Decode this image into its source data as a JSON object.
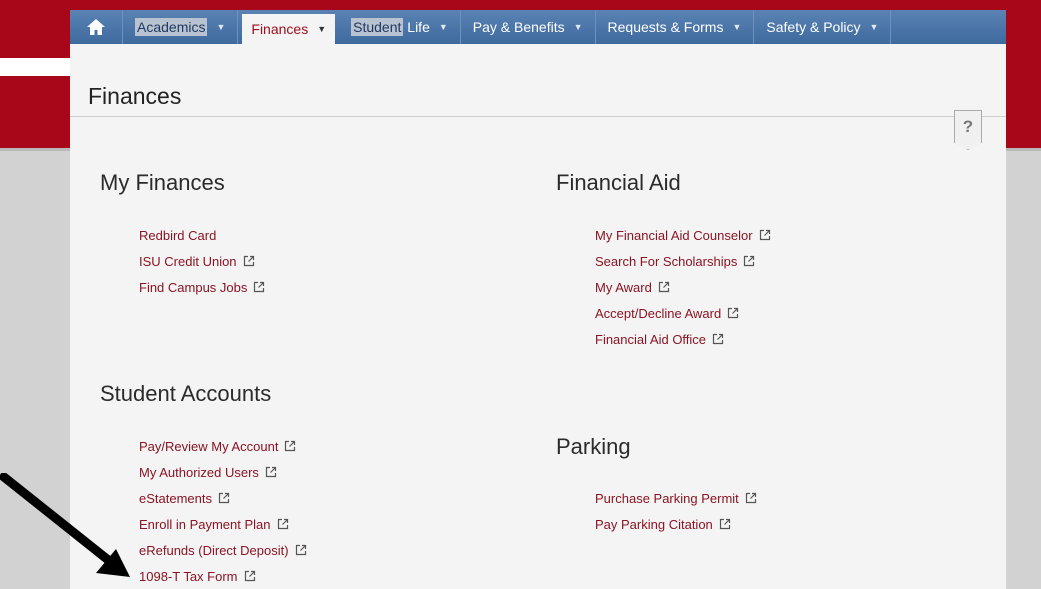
{
  "nav": {
    "items": [
      {
        "label": "Academics",
        "highlight": true,
        "active": false
      },
      {
        "label": "Finances",
        "highlight": false,
        "active": true
      },
      {
        "label": "Student",
        "label2": " Life",
        "highlight": true,
        "active": false
      },
      {
        "label": "Pay & Benefits",
        "highlight": false,
        "active": false
      },
      {
        "label": "Requests & Forms",
        "highlight": false,
        "active": false
      },
      {
        "label": "Safety & Policy",
        "highlight": false,
        "active": false
      }
    ]
  },
  "page": {
    "title": "Finances",
    "help": "?"
  },
  "sections": {
    "my_finances": {
      "title": "My Finances",
      "links": [
        {
          "label": "Redbird Card",
          "external": false
        },
        {
          "label": "ISU Credit Union",
          "external": true
        },
        {
          "label": "Find Campus Jobs",
          "external": true
        }
      ]
    },
    "financial_aid": {
      "title": "Financial Aid",
      "links": [
        {
          "label": "My Financial Aid Counselor",
          "external": true
        },
        {
          "label": "Search For Scholarships",
          "external": true
        },
        {
          "label": "My Award",
          "external": true
        },
        {
          "label": "Accept/Decline Award",
          "external": true
        },
        {
          "label": "Financial Aid Office",
          "external": true
        }
      ]
    },
    "student_accounts": {
      "title": "Student Accounts",
      "links": [
        {
          "label": "Pay/Review My Account",
          "external": true
        },
        {
          "label": "My Authorized Users",
          "external": true
        },
        {
          "label": "eStatements",
          "external": true
        },
        {
          "label": "Enroll in Payment Plan",
          "external": true
        },
        {
          "label": "eRefunds (Direct Deposit)",
          "external": true
        },
        {
          "label": "1098-T Tax Form",
          "external": true
        }
      ]
    },
    "parking": {
      "title": "Parking",
      "links": [
        {
          "label": "Purchase Parking Permit",
          "external": true
        },
        {
          "label": "Pay Parking Citation",
          "external": true
        }
      ]
    }
  },
  "colors": {
    "brand_red": "#a8071a",
    "nav_blue": "#4a75a8",
    "link": "#8a1423"
  }
}
